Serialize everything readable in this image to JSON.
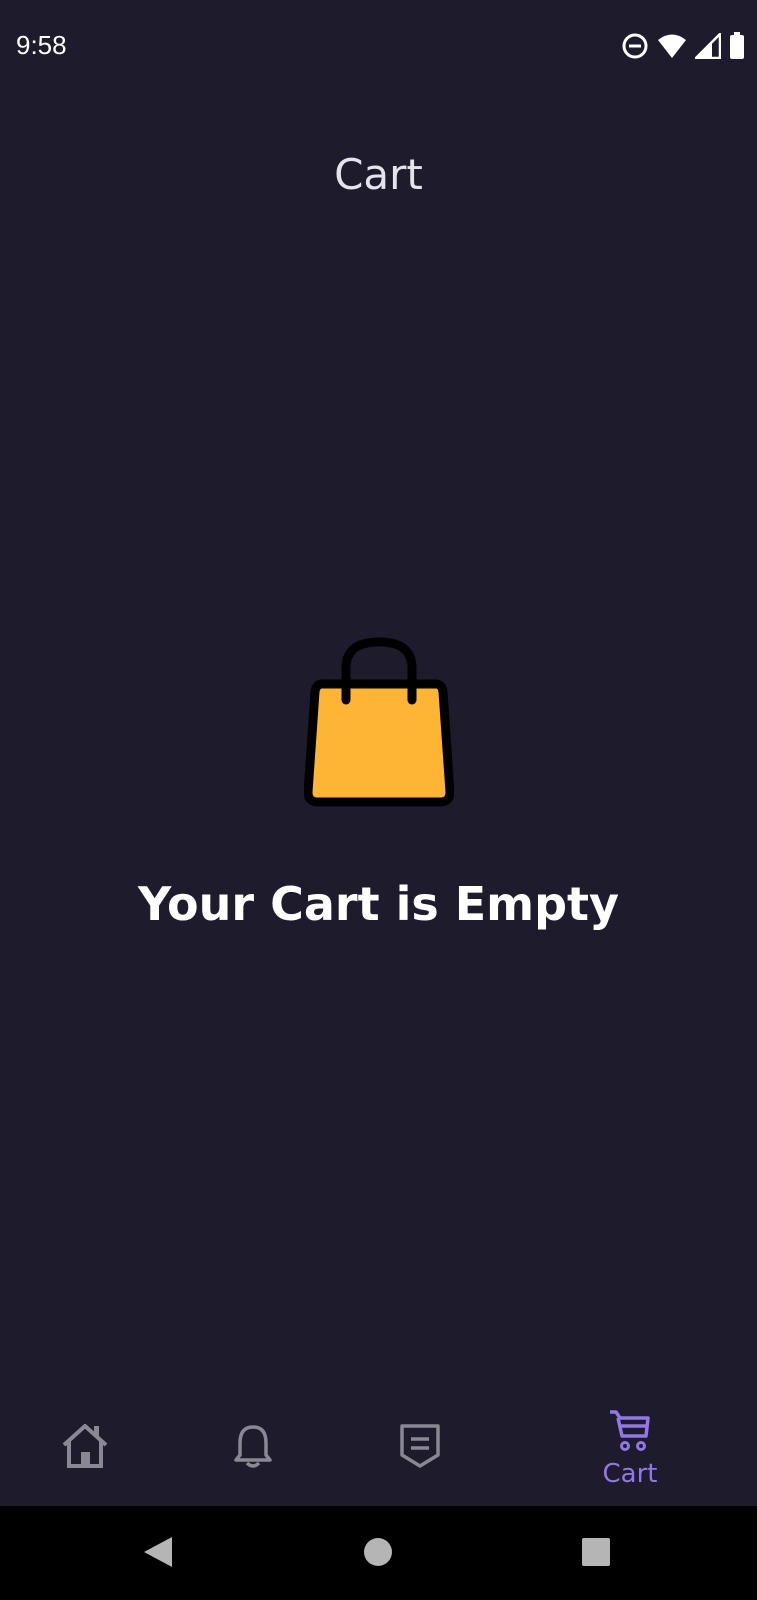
{
  "status_bar": {
    "time": "9:58",
    "icons": [
      "do-not-disturb-icon",
      "wifi-icon",
      "cellular-signal-icon",
      "battery-icon"
    ]
  },
  "header": {
    "title": "Cart"
  },
  "empty_state": {
    "icon": "shopping-bag-icon",
    "message": "Your Cart is Empty",
    "icon_color": "#FFB534"
  },
  "bottom_nav": {
    "items": [
      {
        "icon": "home-icon",
        "label": "",
        "active": false
      },
      {
        "icon": "bell-icon",
        "label": "",
        "active": false
      },
      {
        "icon": "shield-badge-icon",
        "label": "",
        "active": false
      },
      {
        "icon": "cart-icon",
        "label": "Cart",
        "active": true
      }
    ],
    "active_color": "#9277E8",
    "inactive_color": "#8A8893"
  },
  "system_nav": {
    "buttons": [
      "back-icon",
      "home-circle-icon",
      "recents-icon"
    ]
  },
  "colors": {
    "background": "#1E1B2C",
    "text": "#FFFFFF"
  }
}
